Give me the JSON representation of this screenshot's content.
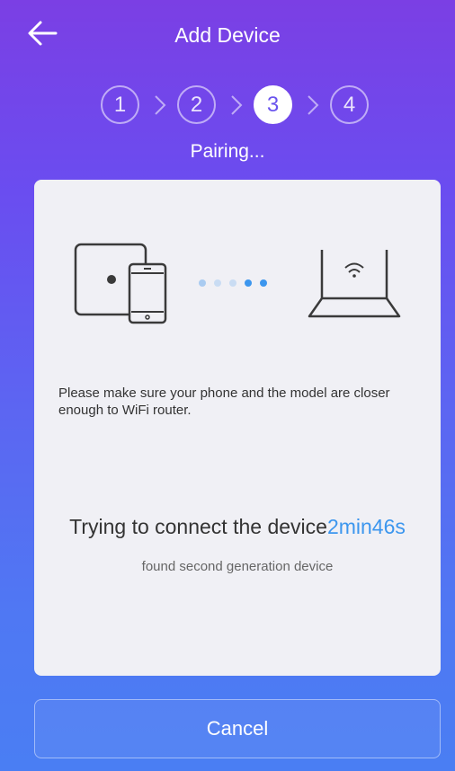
{
  "header": {
    "title": "Add Device",
    "back_icon": "arrow-left-icon"
  },
  "stepper": {
    "steps": [
      "1",
      "2",
      "3",
      "4"
    ],
    "active_step": 3,
    "status": "Pairing..."
  },
  "card": {
    "hint": "Please make sure your phone and the model are closer enough to WiFi router.",
    "connect_text": "Trying to connect the device",
    "timer": "2min46s",
    "found_text": "found second generation device",
    "illustration_left_icon": "device-and-phone-icon",
    "illustration_right_icon": "wifi-router-icon"
  },
  "footer": {
    "cancel_label": "Cancel"
  },
  "colors": {
    "accent": "#3c96ee",
    "card_bg": "#f0f0f5",
    "active_step_text": "#6a54ee"
  }
}
